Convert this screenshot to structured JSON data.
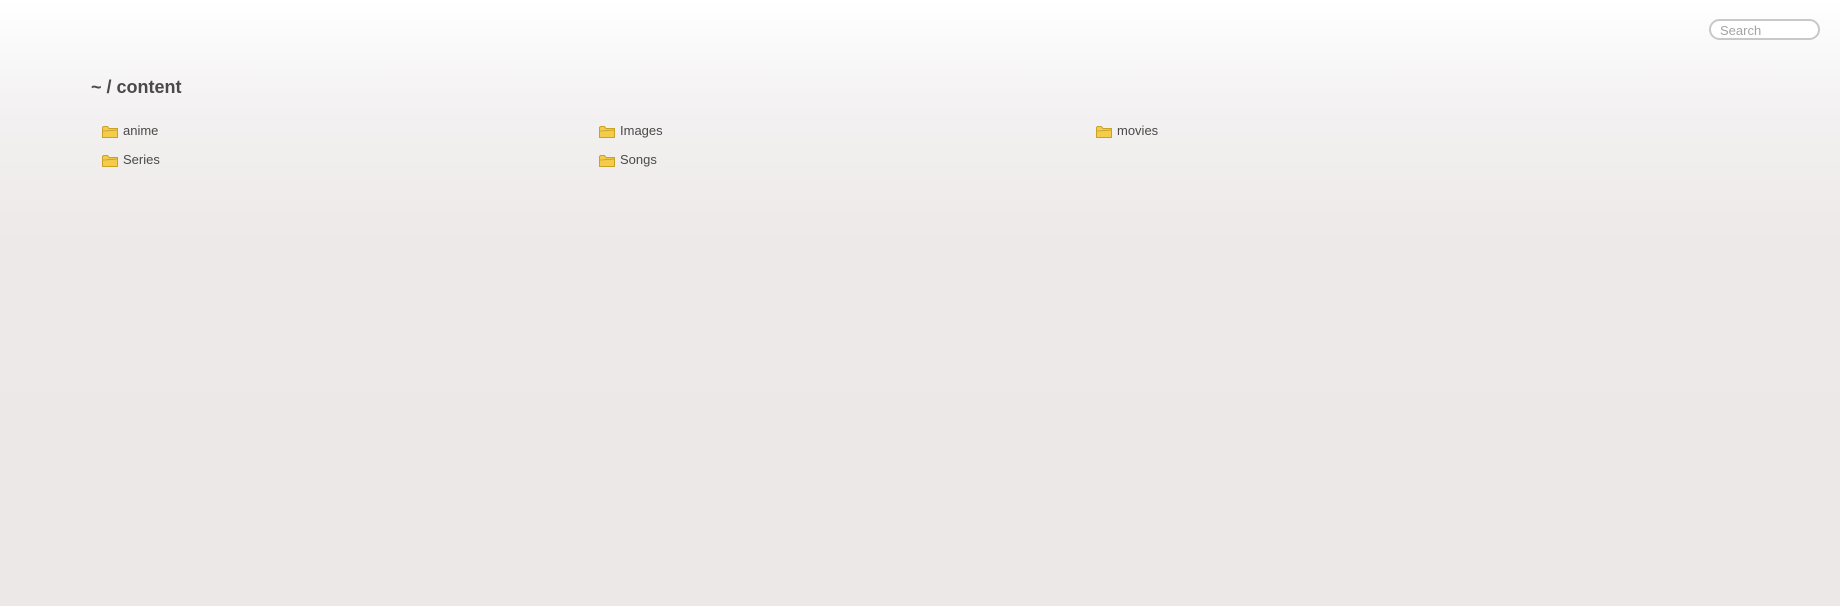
{
  "search": {
    "placeholder": "Search",
    "value": ""
  },
  "breadcrumb": {
    "text": "~ / content"
  },
  "folders": [
    {
      "name": "anime",
      "icon": "folder-icon"
    },
    {
      "name": "Images",
      "icon": "folder-icon"
    },
    {
      "name": "movies",
      "icon": "folder-icon"
    },
    {
      "name": "Series",
      "icon": "folder-icon"
    },
    {
      "name": "Songs",
      "icon": "folder-icon"
    }
  ],
  "colors": {
    "folder_fill": "#f5cc4a",
    "folder_light": "#fbe9a6",
    "folder_stroke": "#c9a227",
    "text": "#4a4a4a"
  }
}
